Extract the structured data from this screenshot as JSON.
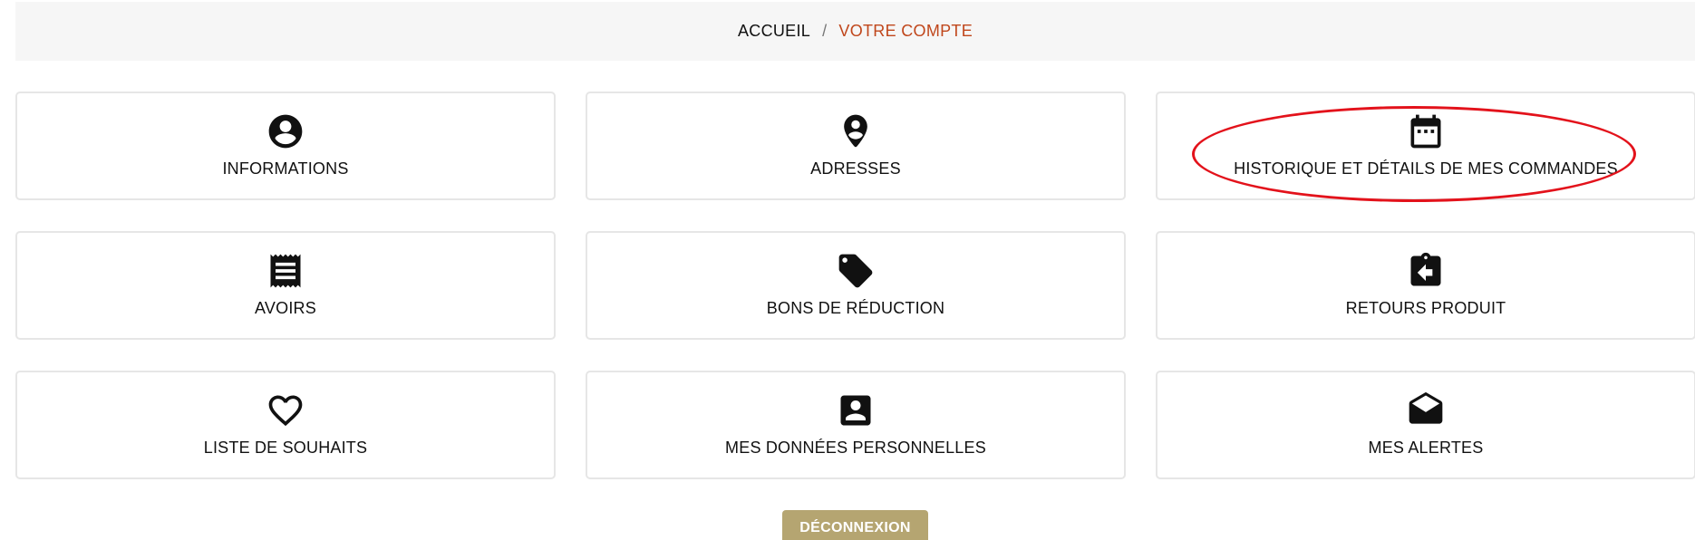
{
  "breadcrumb": {
    "home": "ACCUEIL",
    "separator": "/",
    "current": "VOTRE COMPTE"
  },
  "tiles": [
    {
      "label": "INFORMATIONS",
      "icon": "account-circle-icon"
    },
    {
      "label": "ADRESSES",
      "icon": "location-pin-icon"
    },
    {
      "label": "HISTORIQUE ET DÉTAILS DE MES COMMANDES",
      "icon": "calendar-icon"
    },
    {
      "label": "AVOIRS",
      "icon": "receipt-icon"
    },
    {
      "label": "BONS DE RÉDUCTION",
      "icon": "tag-icon"
    },
    {
      "label": "RETOURS PRODUIT",
      "icon": "clipboard-return-icon"
    },
    {
      "label": "LISTE DE SOUHAITS",
      "icon": "heart-icon"
    },
    {
      "label": "MES DONNÉES PERSONNELLES",
      "icon": "account-box-icon"
    },
    {
      "label": "MES ALERTES",
      "icon": "open-envelope-icon"
    }
  ],
  "logout_label": "DÉCONNEXION",
  "colors": {
    "breadcrumb_bg": "#f6f6f6",
    "breadcrumb_current": "#c0471c",
    "logout_bg": "#b5a571",
    "highlight_ellipse": "#e3121b"
  }
}
